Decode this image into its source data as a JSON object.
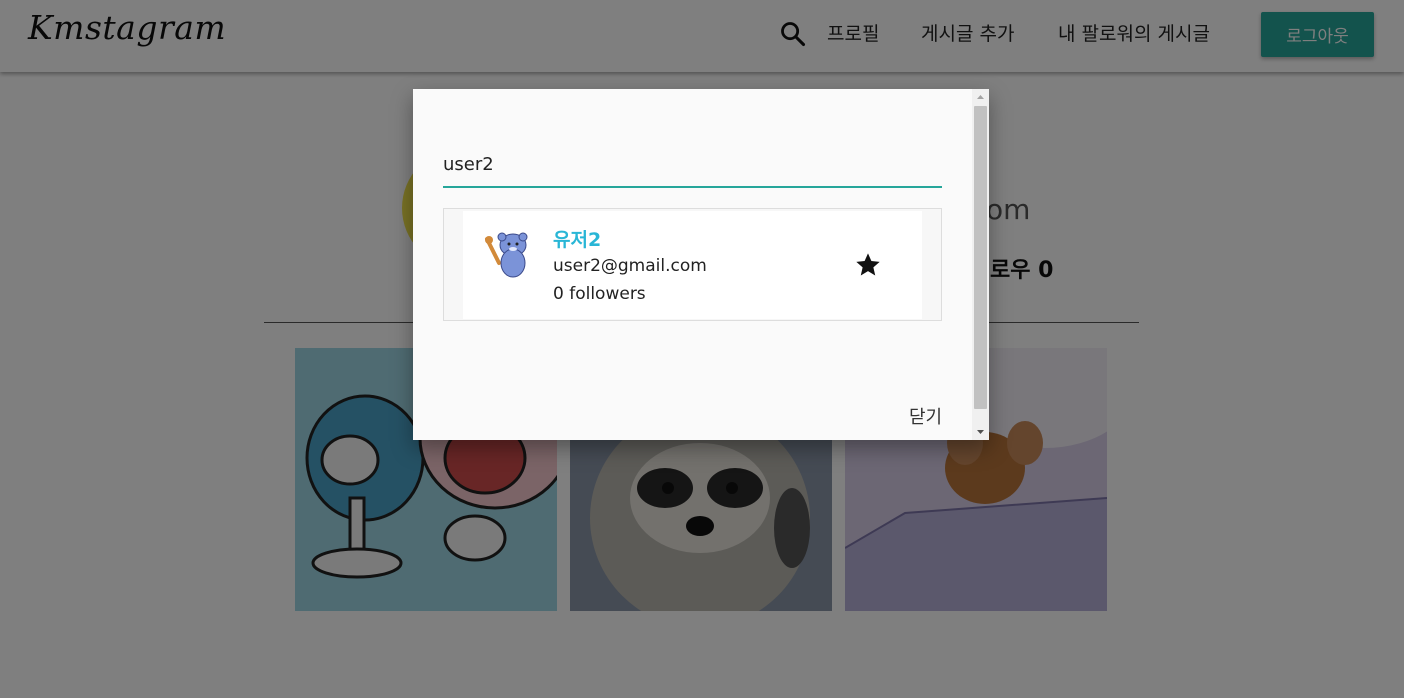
{
  "navbar": {
    "logo": "Kmstagram",
    "search_icon": "search-icon",
    "links": [
      "프로필",
      "게시글 추가",
      "내 팔로워의 게시글"
    ],
    "logout_label": "로그아웃"
  },
  "background": {
    "email_fragment": "om",
    "follow_fragment": "로우 0",
    "posts": [
      {
        "name": "fan-cartoon-image"
      },
      {
        "name": "raccoon-image"
      },
      {
        "name": "cartoon-mouse-image"
      }
    ]
  },
  "modal": {
    "search_value": "user2",
    "results": [
      {
        "avatar_icon": "bear-avatar-icon",
        "name": "유저2",
        "email": "user2@gmail.com",
        "followers": "0 followers",
        "action_icon": "star-icon"
      }
    ],
    "close_label": "닫기"
  },
  "colors": {
    "accent": "#26a69a",
    "username": "#29b6d6",
    "overlay": "rgba(0,0,0,0.5)"
  }
}
